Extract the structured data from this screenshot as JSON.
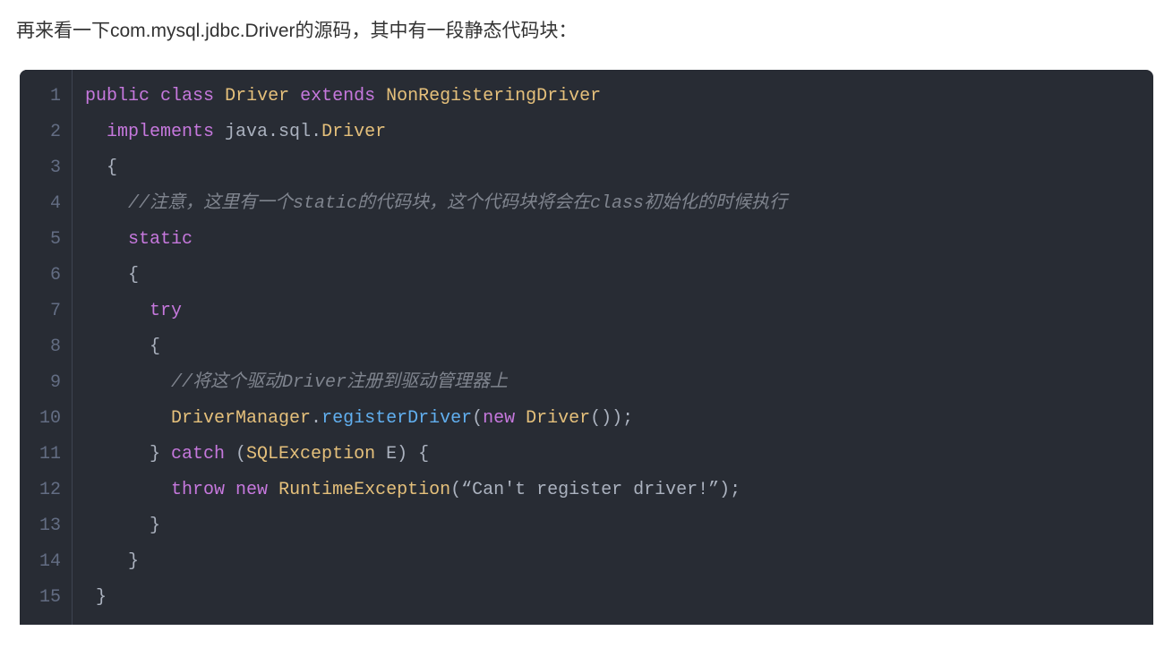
{
  "intro_text": "再来看一下com.mysql.jdbc.Driver的源码，其中有一段静态代码块：",
  "code": {
    "line_count": 15,
    "lines": [
      [
        {
          "cls": "tok-keyword",
          "t": "public"
        },
        {
          "cls": "tok-plain",
          "t": " "
        },
        {
          "cls": "tok-keyword",
          "t": "class"
        },
        {
          "cls": "tok-plain",
          "t": " "
        },
        {
          "cls": "tok-type",
          "t": "Driver"
        },
        {
          "cls": "tok-plain",
          "t": " "
        },
        {
          "cls": "tok-keyword",
          "t": "extends"
        },
        {
          "cls": "tok-plain",
          "t": " "
        },
        {
          "cls": "tok-type",
          "t": "NonRegisteringDriver"
        }
      ],
      [
        {
          "cls": "tok-plain",
          "t": "  "
        },
        {
          "cls": "tok-keyword",
          "t": "implements"
        },
        {
          "cls": "tok-plain",
          "t": " java.sql."
        },
        {
          "cls": "tok-type",
          "t": "Driver"
        }
      ],
      [
        {
          "cls": "tok-plain",
          "t": "  {"
        }
      ],
      [
        {
          "cls": "tok-plain",
          "t": "    "
        },
        {
          "cls": "tok-comment",
          "t": "//注意，这里有一个static的代码块，这个代码块将会在class初始化的时候执行"
        }
      ],
      [
        {
          "cls": "tok-plain",
          "t": "    "
        },
        {
          "cls": "tok-keyword",
          "t": "static"
        }
      ],
      [
        {
          "cls": "tok-plain",
          "t": "    {"
        }
      ],
      [
        {
          "cls": "tok-plain",
          "t": "      "
        },
        {
          "cls": "tok-keyword",
          "t": "try"
        }
      ],
      [
        {
          "cls": "tok-plain",
          "t": "      {"
        }
      ],
      [
        {
          "cls": "tok-plain",
          "t": "        "
        },
        {
          "cls": "tok-comment",
          "t": "//将这个驱动Driver注册到驱动管理器上"
        }
      ],
      [
        {
          "cls": "tok-plain",
          "t": "        "
        },
        {
          "cls": "tok-type",
          "t": "DriverManager"
        },
        {
          "cls": "tok-plain",
          "t": "."
        },
        {
          "cls": "tok-func",
          "t": "registerDriver"
        },
        {
          "cls": "tok-plain",
          "t": "("
        },
        {
          "cls": "tok-keyword",
          "t": "new"
        },
        {
          "cls": "tok-plain",
          "t": " "
        },
        {
          "cls": "tok-type",
          "t": "Driver"
        },
        {
          "cls": "tok-plain",
          "t": "());"
        }
      ],
      [
        {
          "cls": "tok-plain",
          "t": "      } "
        },
        {
          "cls": "tok-keyword",
          "t": "catch"
        },
        {
          "cls": "tok-plain",
          "t": " ("
        },
        {
          "cls": "tok-type",
          "t": "SQLException"
        },
        {
          "cls": "tok-plain",
          "t": " E) {"
        }
      ],
      [
        {
          "cls": "tok-plain",
          "t": "        "
        },
        {
          "cls": "tok-keyword",
          "t": "throw"
        },
        {
          "cls": "tok-plain",
          "t": " "
        },
        {
          "cls": "tok-keyword",
          "t": "new"
        },
        {
          "cls": "tok-plain",
          "t": " "
        },
        {
          "cls": "tok-type",
          "t": "RuntimeException"
        },
        {
          "cls": "tok-plain",
          "t": "(“Can't register driver!”);"
        }
      ],
      [
        {
          "cls": "tok-plain",
          "t": "      }"
        }
      ],
      [
        {
          "cls": "tok-plain",
          "t": "    }"
        }
      ],
      [
        {
          "cls": "tok-plain",
          "t": " }"
        }
      ]
    ]
  }
}
